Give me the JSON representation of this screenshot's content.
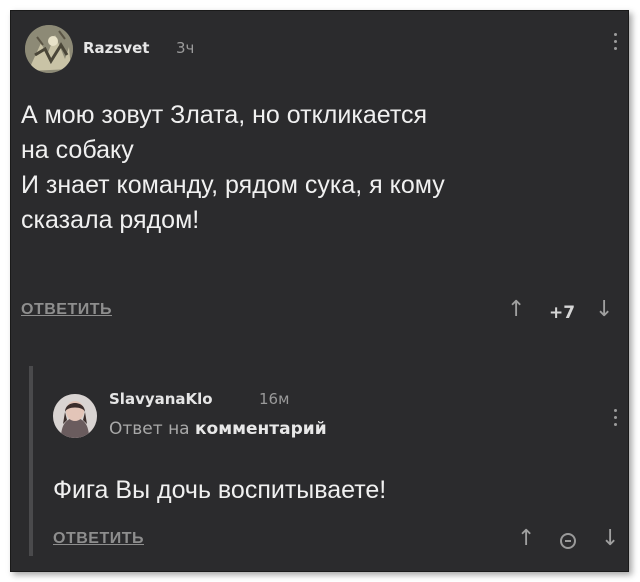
{
  "comments": [
    {
      "username": "Razsvet",
      "time": "3ч",
      "text_lines": [
        "А мою зовут Злата, но откликается",
        "на собаку",
        "И знает команду, рядом сука, я кому",
        "сказала рядом!"
      ],
      "reply_label": "ОТВЕТИТЬ",
      "score": "+7",
      "upvote_glyph": "↑",
      "downvote_glyph": "↓"
    },
    {
      "username": "SlavyanaKlo",
      "time": "16м",
      "reply_to_prefix": "Ответ на",
      "reply_to_target": "комментарий",
      "text": "Фига Вы дочь воспитываете!",
      "reply_label": "ОТВЕТИТЬ",
      "upvote_glyph": "↑",
      "downvote_glyph": "↓"
    }
  ],
  "icons": {
    "avatar1": "avatar-icon",
    "avatar2": "avatar-icon",
    "menu": "more-vertical-icon",
    "score_hidden": "score-hidden-icon"
  },
  "colors": {
    "background": "#2b2b2d",
    "text": "#f0f0f0",
    "muted": "#9a9a9a"
  }
}
